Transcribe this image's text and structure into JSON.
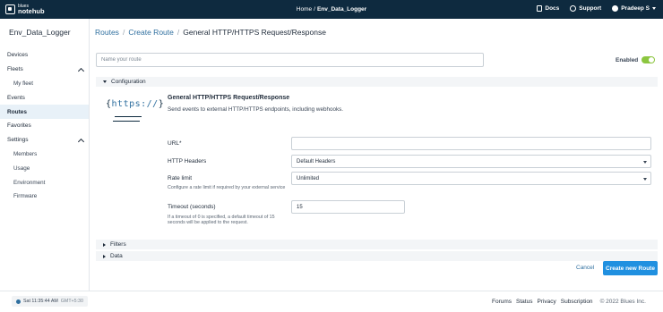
{
  "topbar": {
    "logo_small": "blues",
    "logo_big": "notehub",
    "home": "Home",
    "separator": "/",
    "app_name": "Env_Data_Logger",
    "docs": "Docs",
    "support": "Support",
    "user": "Pradeep S"
  },
  "sidebar": {
    "project": "Env_Data_Logger",
    "items": [
      {
        "label": "Devices"
      },
      {
        "label": "Fleets"
      },
      {
        "label": "My fleet"
      },
      {
        "label": "Events"
      },
      {
        "label": "Routes"
      },
      {
        "label": "Favorites"
      },
      {
        "label": "Settings"
      },
      {
        "label": "Members"
      },
      {
        "label": "Usage"
      },
      {
        "label": "Environment"
      },
      {
        "label": "Firmware"
      }
    ]
  },
  "breadcrumb": {
    "routes": "Routes",
    "create_route": "Create Route",
    "current": "General HTTP/HTTPS Request/Response",
    "sep": "/"
  },
  "route_name": {
    "placeholder": "Name your route",
    "value": ""
  },
  "enabled": {
    "label": "Enabled",
    "on": true,
    "color": "#8cc63f"
  },
  "sections": {
    "configuration": "Configuration",
    "filters": "Filters",
    "data": "Data"
  },
  "config": {
    "logo_text": "https://",
    "title": "General HTTP/HTTPS Request/Response",
    "description": "Send events to external HTTP/HTTPS endpoints, including webhooks.",
    "url_label": "URL*",
    "url_value": "",
    "headers_label": "HTTP Headers",
    "headers_value": "Default Headers",
    "rate_label": "Rate limit",
    "rate_help": "Configure a rate limit if required by your external service",
    "rate_value": "Unlimited",
    "timeout_label": "Timeout (seconds)",
    "timeout_help": "If a timeout of 0 is specified, a default timeout of 15 seconds will be applied to the request.",
    "timeout_value": "15"
  },
  "actions": {
    "cancel": "Cancel",
    "create": "Create new Route",
    "accent": "#2090e0"
  },
  "footer": {
    "clock": "Sat 11:35:44 AM",
    "timezone": "GMT+5:30",
    "links": [
      "Forums",
      "Status",
      "Privacy",
      "Subscription"
    ],
    "copyright": "© 2022 Blues Inc."
  }
}
